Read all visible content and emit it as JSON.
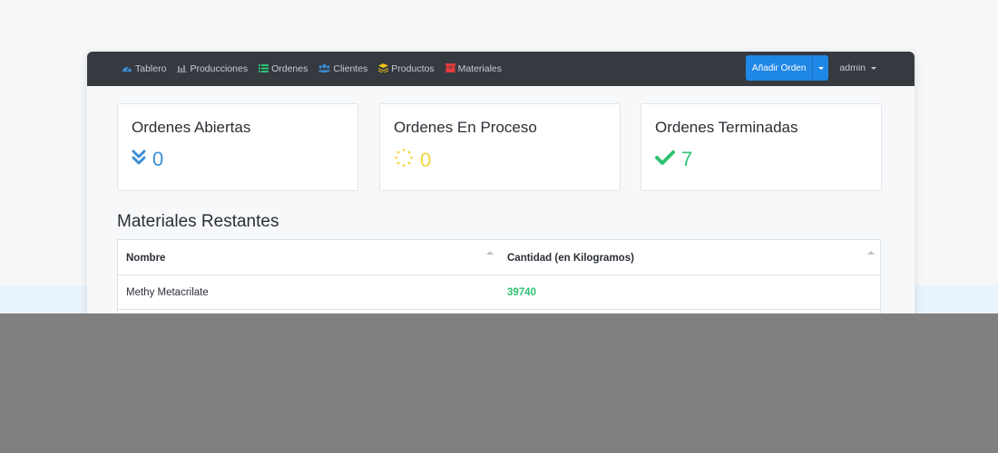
{
  "nav": {
    "items": [
      {
        "label": "Tablero",
        "icon": "tachometer-icon",
        "icon_color": "#3a8fd6"
      },
      {
        "label": "Producciones",
        "icon": "bar-chart-icon",
        "icon_color": "#8c9198"
      },
      {
        "label": "Ordenes",
        "icon": "list-icon",
        "icon_color": "#2ec271"
      },
      {
        "label": "Clientes",
        "icon": "users-icon",
        "icon_color": "#3a8fd6"
      },
      {
        "label": "Productos",
        "icon": "layers-icon",
        "icon_color": "#f0c419"
      },
      {
        "label": "Materiales",
        "icon": "box-icon",
        "icon_color": "#e23b3b"
      }
    ],
    "add_order_label": "Añadir Orden",
    "user_label": "admin"
  },
  "cards": [
    {
      "title": "Ordenes Abiertas",
      "value": "0",
      "icon": "double-chevron-down-icon",
      "color": "#3a8fd6"
    },
    {
      "title": "Ordenes En Proceso",
      "value": "0",
      "icon": "spinner-icon",
      "color": "#f5d63d"
    },
    {
      "title": "Ordenes Terminadas",
      "value": "7",
      "icon": "check-icon",
      "color": "#2ec271"
    }
  ],
  "materials": {
    "title": "Materiales Restantes",
    "columns": [
      "Nombre",
      "Cantidad (en Kilogramos)"
    ],
    "rows": [
      {
        "name": "Methy Metacrilate",
        "quantity": "39740"
      }
    ]
  },
  "colors": {
    "navbar": "#353a40",
    "accent": "#1f87e5",
    "success": "#2ec271"
  }
}
